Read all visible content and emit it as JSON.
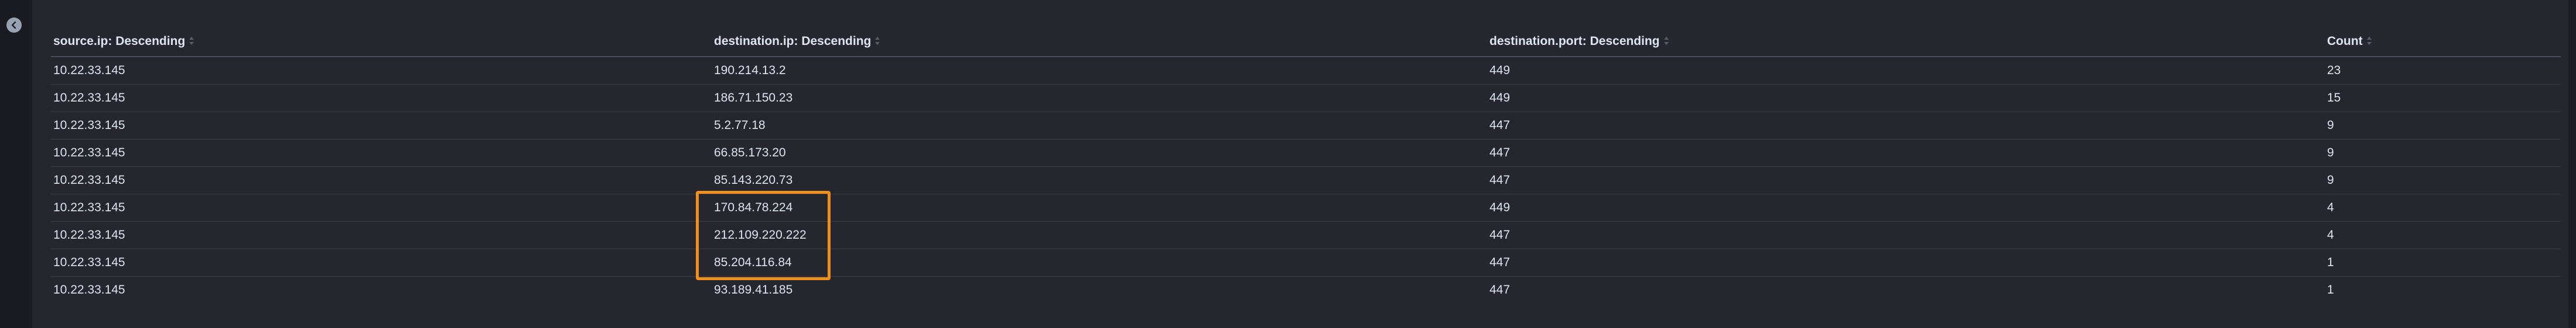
{
  "sidebar": {
    "collapse_icon": "chevron-left-icon"
  },
  "table": {
    "columns": [
      "source.ip: Descending",
      "destination.ip: Descending",
      "destination.port: Descending",
      "Count"
    ],
    "rows": [
      [
        "10.22.33.145",
        "190.214.13.2",
        "449",
        "23"
      ],
      [
        "10.22.33.145",
        "186.71.150.23",
        "449",
        "15"
      ],
      [
        "10.22.33.145",
        "5.2.77.18",
        "447",
        "9"
      ],
      [
        "10.22.33.145",
        "66.85.173.20",
        "447",
        "9"
      ],
      [
        "10.22.33.145",
        "85.143.220.73",
        "447",
        "9"
      ],
      [
        "10.22.33.145",
        "170.84.78.224",
        "449",
        "4"
      ],
      [
        "10.22.33.145",
        "212.109.220.222",
        "447",
        "4"
      ],
      [
        "10.22.33.145",
        "85.204.116.84",
        "447",
        "1"
      ],
      [
        "10.22.33.145",
        "93.189.41.185",
        "447",
        "1"
      ]
    ]
  },
  "annotation": {
    "color": "#f0901a"
  },
  "colors": {
    "background": "#1d1e24",
    "panel": "#25262e",
    "text": "#dfe5ef"
  }
}
